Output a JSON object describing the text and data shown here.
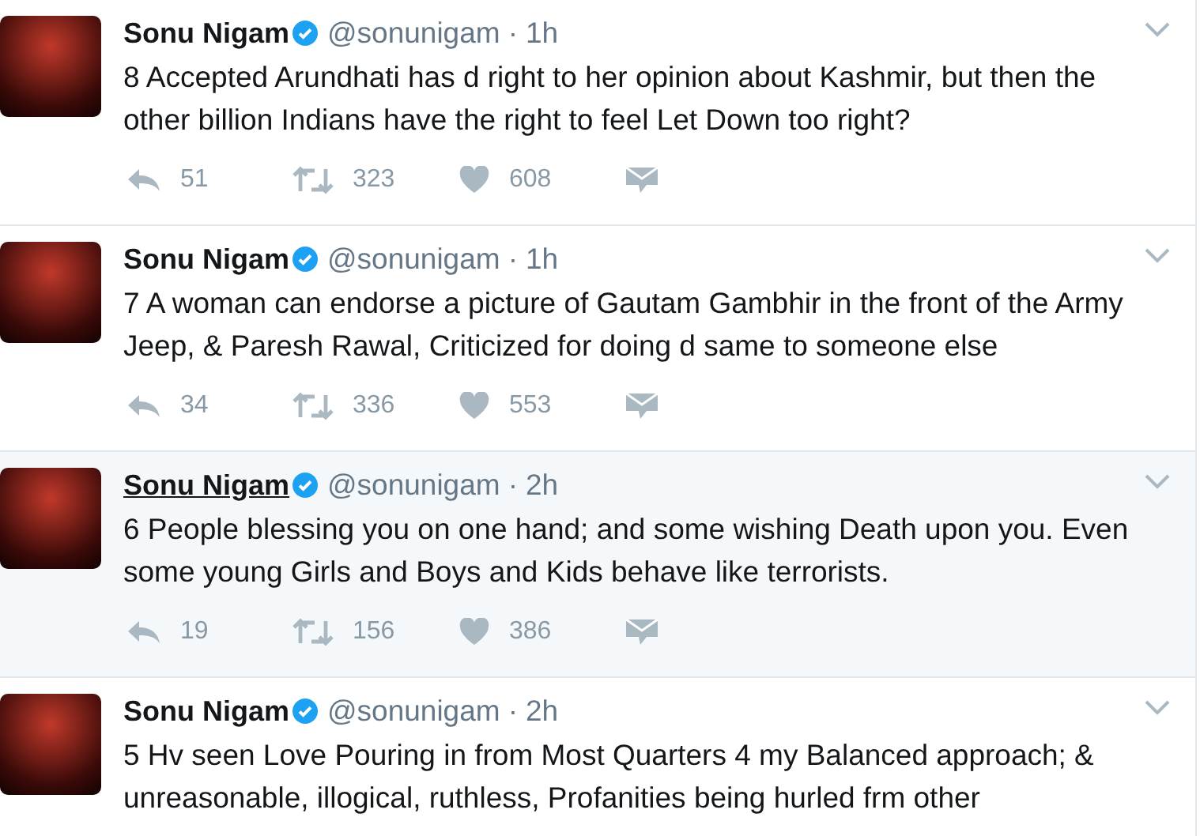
{
  "tweets": [
    {
      "name": "Sonu Nigam",
      "verified": true,
      "handle": "@sonunigam",
      "separator": "·",
      "time": "1h",
      "hovered": false,
      "text": "8 Accepted Arundhati has d right to her opinion about Kashmir, but then the other billion Indians have the right to feel Let Down too right?",
      "replies": "51",
      "retweets": "323",
      "likes": "608"
    },
    {
      "name": "Sonu Nigam",
      "verified": true,
      "handle": "@sonunigam",
      "separator": "·",
      "time": "1h",
      "hovered": false,
      "text": "7 A woman can endorse a picture of Gautam Gambhir in the front of the Army Jeep, & Paresh Rawal, Criticized for doing d same to someone else",
      "replies": "34",
      "retweets": "336",
      "likes": "553"
    },
    {
      "name": "Sonu Nigam",
      "verified": true,
      "handle": "@sonunigam",
      "separator": "·",
      "time": "2h",
      "hovered": true,
      "text": "6 People blessing you on one hand; and some wishing Death upon you. Even some young Girls and Boys and Kids behave like terrorists.",
      "replies": "19",
      "retweets": "156",
      "likes": "386"
    },
    {
      "name": "Sonu Nigam",
      "verified": true,
      "handle": "@sonunigam",
      "separator": "·",
      "time": "2h",
      "hovered": false,
      "text": "5 Hv seen Love Pouring in from Most Quarters 4 my Balanced approach; & unreasonable, illogical, ruthless, Profanities being hurled frm other"
    }
  ]
}
